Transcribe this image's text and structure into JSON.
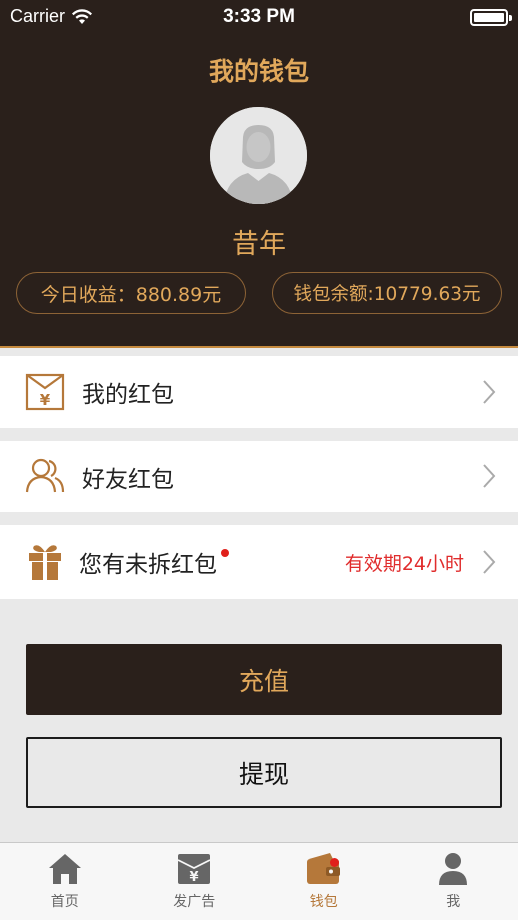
{
  "status_bar": {
    "carrier": "Carrier",
    "time": "3:33 PM"
  },
  "header": {
    "title": "我的钱包",
    "user_name": "昔年",
    "today_earnings": "今日收益：880.89元",
    "wallet_balance": "钱包余额:10779.63元"
  },
  "menu": {
    "my_red_packet": "我的红包",
    "friend_red_packet": "好友红包",
    "unopened": {
      "label": "您有未拆红包",
      "note": "有效期24小时"
    }
  },
  "buttons": {
    "recharge": "充值",
    "withdraw": "提现"
  },
  "tabbar": {
    "tabs": [
      {
        "label": "首页",
        "icon": "home-icon"
      },
      {
        "label": "发广告",
        "icon": "yen-board-icon"
      },
      {
        "label": "钱包",
        "icon": "wallet-icon"
      },
      {
        "label": "我",
        "icon": "person-icon"
      }
    ],
    "active_index": 2
  },
  "colors": {
    "header_bg": "#2a201b",
    "accent": "#e1a85b",
    "alert": "#e02c2c"
  }
}
